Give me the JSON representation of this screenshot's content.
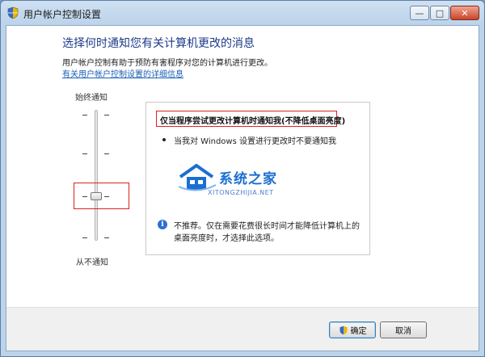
{
  "window": {
    "title": "用户帐户控制设置",
    "caption_buttons": {
      "minimize": "—",
      "maximize": "□",
      "close": "✕"
    }
  },
  "main": {
    "heading": "选择何时通知您有关计算机更改的消息",
    "description": "用户帐户控制有助于预防有害程序对您的计算机进行更改。",
    "link": "有关用户帐户控制设置的详细信息"
  },
  "slider": {
    "top_label": "始终通知",
    "bottom_label": "从不通知",
    "levels": 4,
    "selected_level": 2
  },
  "panel": {
    "setting_title": "仅当程序尝试更改计算机时通知我(不降低桌面亮度)",
    "bullet": "当我对 Windows 设置进行更改时不要通知我",
    "info_text": "不推荐。仅在需要花费很长时间才能降低计算机上的桌面亮度时，才选择此选项。",
    "watermark_text": "系统之家",
    "watermark_url": "XITONGZHIJIA.NET"
  },
  "buttons": {
    "ok": "确定",
    "cancel": "取消"
  },
  "colors": {
    "heading": "#1e3a8a",
    "link": "#1a5fb4",
    "highlight": "#e02020"
  }
}
